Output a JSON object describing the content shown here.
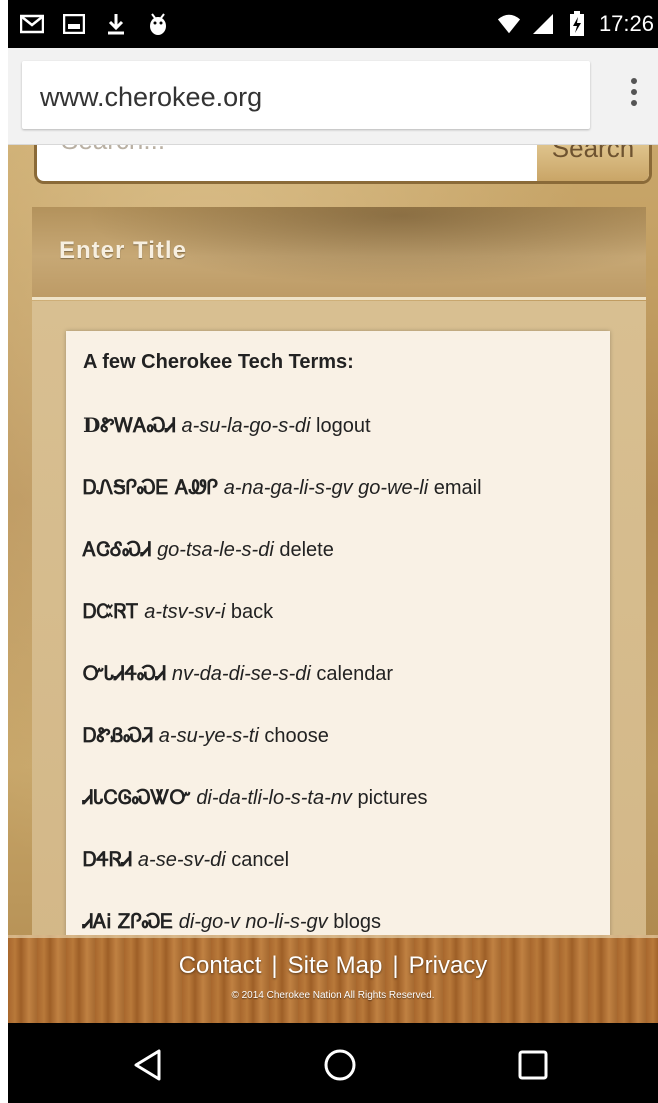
{
  "status_bar": {
    "time": "17:26",
    "left_icons": [
      "gmail-icon",
      "image-icon",
      "download-icon",
      "android-debug-icon"
    ],
    "right_icons": [
      "wifi-icon",
      "signal-icon",
      "battery-charging-icon"
    ]
  },
  "browser": {
    "url": "www.cherokee.org",
    "menu_icon": "overflow-menu-icon"
  },
  "search": {
    "placeholder": "Search...",
    "button_label": "Search"
  },
  "module": {
    "title": "Enter Title",
    "heading": "A few Cherokee Tech Terms:",
    "terms": [
      {
        "cherokee": "DᏑᎳᎪᏍᏗ",
        "translit": "a-su-la-go-s-di",
        "english": "logout"
      },
      {
        "cherokee": "ᎠᏁᎦᎵᏍᎬ ᎪᏪᎵ",
        "translit": "a-na-ga-li-s-gv go-we-li",
        "english": "email"
      },
      {
        "cherokee": "ᎪᏣᎴᏍᏗ",
        "translit": "go-tsa-le-s-di",
        "english": "delete"
      },
      {
        "cherokee": "ᎠᏨᏒᎢ",
        "translit": "a-tsv-sv-i",
        "english": "back"
      },
      {
        "cherokee": "ᏅᏓᏗᏎᏍᏗ",
        "translit": "nv-da-di-se-s-di",
        "english": "calendar"
      },
      {
        "cherokee": "ᎠᏑᏰᏍᏘ",
        "translit": "a-su-ye-s-ti",
        "english": "choose"
      },
      {
        "cherokee": "ᏗᏓᏟᎶᏍᏔᏅ",
        "translit": "di-da-tli-lo-s-ta-nv",
        "english": "pictures"
      },
      {
        "cherokee": "ᎠᏎᏒᏗ",
        "translit": "a-se-sv-di",
        "english": "cancel"
      },
      {
        "cherokee": "ᏗᎪᎥ ᏃᎵᏍᎬ",
        "translit": "di-go-v no-li-s-gv",
        "english": "blogs"
      }
    ]
  },
  "footer": {
    "links": [
      "Contact",
      "Site Map",
      "Privacy"
    ],
    "separator": "|",
    "copyright": "© 2014 Cherokee Nation All Rights Reserved."
  },
  "nav_bar": {
    "icons": [
      "back-triangle-icon",
      "home-circle-icon",
      "recents-square-icon"
    ]
  }
}
